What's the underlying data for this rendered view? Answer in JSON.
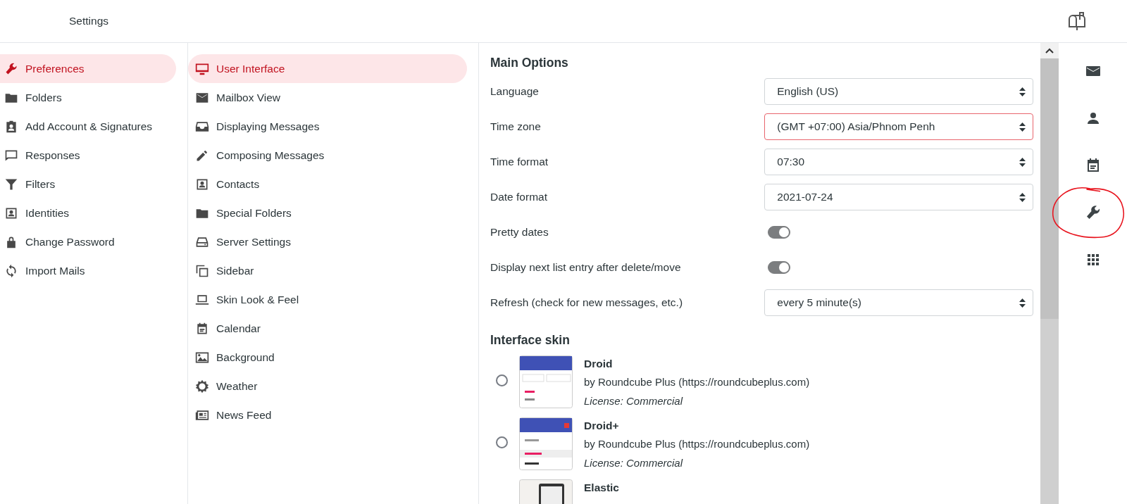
{
  "header": {
    "title": "Settings"
  },
  "sections": [
    {
      "label": "Preferences",
      "selected": true
    },
    {
      "label": "Folders",
      "selected": false
    },
    {
      "label": "Add Account & Signatures",
      "selected": false
    },
    {
      "label": "Responses",
      "selected": false
    },
    {
      "label": "Filters",
      "selected": false
    },
    {
      "label": "Identities",
      "selected": false
    },
    {
      "label": "Change Password",
      "selected": false
    },
    {
      "label": "Import Mails",
      "selected": false
    }
  ],
  "subsections": [
    {
      "label": "User Interface",
      "selected": true
    },
    {
      "label": "Mailbox View",
      "selected": false
    },
    {
      "label": "Displaying Messages",
      "selected": false
    },
    {
      "label": "Composing Messages",
      "selected": false
    },
    {
      "label": "Contacts",
      "selected": false
    },
    {
      "label": "Special Folders",
      "selected": false
    },
    {
      "label": "Server Settings",
      "selected": false
    },
    {
      "label": "Sidebar",
      "selected": false
    },
    {
      "label": "Skin Look & Feel",
      "selected": false
    },
    {
      "label": "Calendar",
      "selected": false
    },
    {
      "label": "Background",
      "selected": false
    },
    {
      "label": "Weather",
      "selected": false
    },
    {
      "label": "News Feed",
      "selected": false
    }
  ],
  "main_options": {
    "title": "Main Options",
    "rows": [
      {
        "kind": "select",
        "label": "Language",
        "value": "English (US)",
        "invalid": false
      },
      {
        "kind": "select",
        "label": "Time zone",
        "value": "(GMT +07:00) Asia/Phnom Penh",
        "invalid": true
      },
      {
        "kind": "select",
        "label": "Time format",
        "value": "07:30",
        "invalid": false
      },
      {
        "kind": "select",
        "label": "Date format",
        "value": "2021-07-24",
        "invalid": false
      },
      {
        "kind": "toggle",
        "label": "Pretty dates",
        "on": true
      },
      {
        "kind": "toggle",
        "label": "Display next list entry after delete/move",
        "on": true
      },
      {
        "kind": "select",
        "label": "Refresh (check for new messages, etc.)",
        "value": "every 5 minute(s)",
        "invalid": false
      }
    ]
  },
  "interface_skin": {
    "title": "Interface skin",
    "items": [
      {
        "name": "Droid",
        "author": "by Roundcube Plus (https://roundcubeplus.com)",
        "license": "License: Commercial",
        "selected": false
      },
      {
        "name": "Droid+",
        "author": "by Roundcube Plus (https://roundcubeplus.com)",
        "license": "License: Commercial",
        "selected": false
      },
      {
        "name": "Elastic"
      }
    ]
  }
}
